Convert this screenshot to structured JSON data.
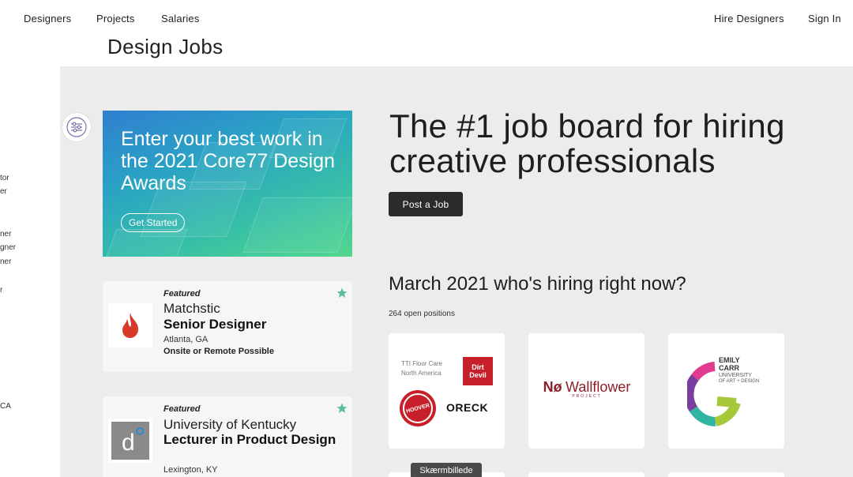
{
  "nav": {
    "designers": "Designers",
    "projects": "Projects",
    "salaries": "Salaries",
    "hire": "Hire Designers",
    "signin": "Sign In"
  },
  "page": {
    "title": "Design Jobs"
  },
  "sidebar": {
    "items": [
      "tor",
      "er",
      "ner",
      "gner",
      "ner",
      "r",
      "CA"
    ]
  },
  "banner": {
    "text": "Enter your best work in the 2021 Core77 Design Awards",
    "cta": "Get Started"
  },
  "hero": {
    "headline": "The #1 job board for hiring creative professionals",
    "post_job": "Post a Job"
  },
  "hiring": {
    "title": "March 2021 who's hiring right now?",
    "open_positions": "264 open positions"
  },
  "jobs": [
    {
      "featured": "Featured",
      "company": "Matchstic",
      "role": "Senior Designer",
      "location": "Atlanta, GA",
      "remote": "Onsite or Remote Possible",
      "logo_icon": "matchstic-flame-icon",
      "logo_color": "#d83a2a"
    },
    {
      "featured": "Featured",
      "company": "University of Kentucky",
      "role": "Lecturer in Product Design",
      "location": "Lexington, KY",
      "logo_icon": "uk-d-icon",
      "logo_color": "#8a8a8a"
    }
  ],
  "employers": {
    "tti": {
      "line1": "TTI Floor Care",
      "line2": "North America",
      "dirt_devil": "Dirt Devil",
      "hoover": "HOOVER",
      "oreck": "ORECK"
    },
    "wallflower": {
      "name": "Wallflower",
      "prefix": "Nø",
      "sub": "PROJECT"
    },
    "emily_carr": {
      "line1": "EMILY",
      "line2": "CARR",
      "line3": "UNIVERSITY",
      "line4": "OF ART + DESIGN"
    }
  },
  "tooltip": "Skærmbillede",
  "colors": {
    "accent_star": "#5bbf9a",
    "brand_red": "#c8202a"
  }
}
